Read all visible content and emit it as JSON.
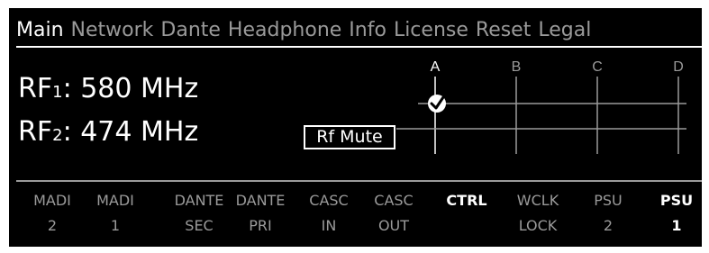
{
  "menu": {
    "tabs": [
      {
        "label": "Main",
        "active": true
      },
      {
        "label": "Network",
        "active": false
      },
      {
        "label": "Dante",
        "active": false
      },
      {
        "label": "Headphone",
        "active": false
      },
      {
        "label": "Info",
        "active": false
      },
      {
        "label": "License",
        "active": false
      },
      {
        "label": "Reset",
        "active": false
      },
      {
        "label": "Legal",
        "active": false
      }
    ]
  },
  "rf": {
    "rf1": {
      "prefix": "RF",
      "sub": "1",
      "freq": ": 580 MHz"
    },
    "rf2": {
      "prefix": "RF",
      "sub": "2",
      "freq": ": 474 MHz"
    },
    "mute_label": "Rf Mute"
  },
  "antenna": {
    "labels": [
      "A",
      "B",
      "C",
      "D"
    ],
    "selected": "A",
    "selected_icon": "check-circle-icon"
  },
  "status": {
    "items": [
      {
        "line1": "MADI",
        "line2": "2",
        "on": false
      },
      {
        "line1": "MADI",
        "line2": "1",
        "on": false
      },
      {
        "line1": "DANTE",
        "line2": "SEC",
        "on": false
      },
      {
        "line1": "DANTE",
        "line2": "PRI",
        "on": false
      },
      {
        "line1": "CASC",
        "line2": "IN",
        "on": false
      },
      {
        "line1": "CASC",
        "line2": "OUT",
        "on": false
      },
      {
        "line1": "CTRL",
        "line2": "",
        "on": true
      },
      {
        "line1": "WCLK",
        "line2": "LOCK",
        "on": false
      },
      {
        "line1": "PSU",
        "line2": "2",
        "on": false
      },
      {
        "line1": "PSU",
        "line2": "1",
        "on": true
      }
    ]
  },
  "colors": {
    "background": "#000000",
    "active": "#ffffff",
    "inactive": "#9a9a9a"
  }
}
